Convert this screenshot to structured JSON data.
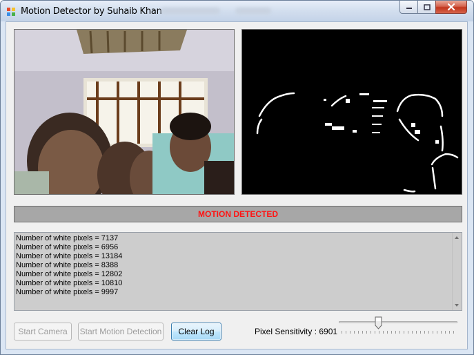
{
  "window": {
    "title": "Motion Detector by Suhaib Khan",
    "controls": {
      "minimize_icon": "minimize-icon",
      "maximize_icon": "maximize-icon",
      "close_icon": "close-icon"
    }
  },
  "views": {
    "camera_icon": "camera-feed",
    "motion_icon": "motion-mask"
  },
  "status": {
    "text": "MOTION DETECTED",
    "color": "#ff1313"
  },
  "log": {
    "lines": [
      "Number of white pixels = 7137",
      "Number of white pixels = 6956",
      "Number of white pixels = 13184",
      "Number of white pixels = 8388",
      "Number of white pixels = 12802",
      "Number of white pixels = 10810",
      "Number of white pixels = 9997"
    ]
  },
  "buttons": {
    "start_camera": "Start Camera",
    "start_motion": "Start Motion Detection",
    "clear_log": "Clear Log"
  },
  "sensitivity": {
    "label": "Pixel Sensitivity : 6901",
    "slider_fraction": 0.32
  },
  "colors": {
    "status_bg": "#a7a7a7",
    "accent_button": "#bee6fd"
  }
}
